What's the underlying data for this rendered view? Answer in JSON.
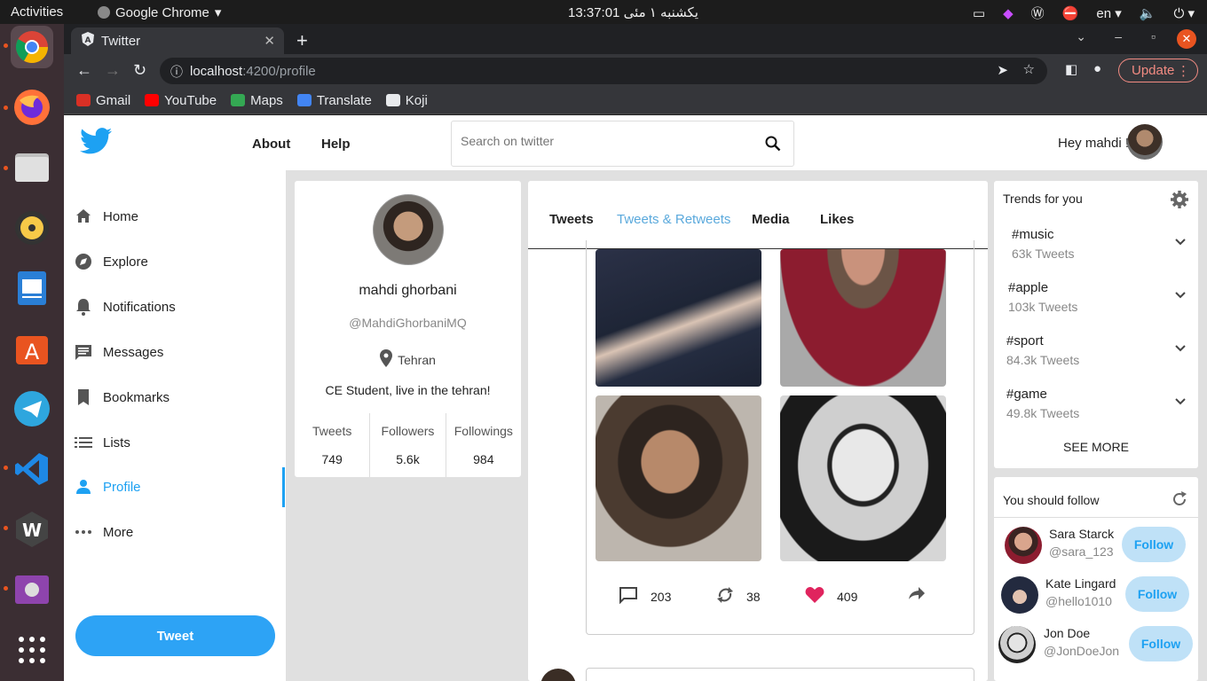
{
  "os": {
    "activities": "Activities",
    "app_name": "Google Chrome",
    "clock": "13:37:01 یکشنبه ۱ مئی",
    "lang": "en"
  },
  "browser": {
    "tab_title": "Twitter",
    "url_host": "localhost",
    "url_path": ":4200/profile",
    "update_label": "Update",
    "bookmarks": [
      {
        "label": "Gmail",
        "color": "#d93025"
      },
      {
        "label": "YouTube",
        "color": "#ff0000"
      },
      {
        "label": "Maps",
        "color": "#34a853"
      },
      {
        "label": "Translate",
        "color": "#4285f4"
      },
      {
        "label": "Koji",
        "color": "#222222"
      }
    ]
  },
  "header": {
    "nav_about": "About",
    "nav_help": "Help",
    "search_placeholder": "Search on twitter",
    "greeting": "Hey mahdi !"
  },
  "sidebar": {
    "items": [
      {
        "label": "Home",
        "icon": "home-icon"
      },
      {
        "label": "Explore",
        "icon": "explore-icon"
      },
      {
        "label": "Notifications",
        "icon": "bell-icon"
      },
      {
        "label": "Messages",
        "icon": "message-icon"
      },
      {
        "label": "Bookmarks",
        "icon": "bookmark-icon"
      },
      {
        "label": "Lists",
        "icon": "list-icon"
      },
      {
        "label": "Profile",
        "icon": "person-icon"
      },
      {
        "label": "More",
        "icon": "more-icon"
      }
    ],
    "active": "Profile",
    "tweet_button": "Tweet"
  },
  "profile": {
    "name": "mahdi ghorbani",
    "handle": "@MahdiGhorbaniMQ",
    "location": "Tehran",
    "bio": "CE Student, live in the tehran!",
    "stats": [
      {
        "label": "Tweets",
        "value": "749"
      },
      {
        "label": "Followers",
        "value": "5.6k"
      },
      {
        "label": "Followings",
        "value": "984"
      }
    ]
  },
  "feed": {
    "tabs": [
      "Tweets",
      "Tweets & Retweets",
      "Media",
      "Likes"
    ],
    "active_tab": "Tweets & Retweets",
    "tweet": {
      "replies": "203",
      "retweets": "38",
      "likes": "409"
    }
  },
  "trends": {
    "title": "Trends for you",
    "items": [
      {
        "tag": "#music",
        "count": "63k Tweets"
      },
      {
        "tag": "#apple",
        "count": "103k Tweets"
      },
      {
        "tag": "#sport",
        "count": "84.3k Tweets"
      },
      {
        "tag": "#game",
        "count": "49.8k Tweets"
      }
    ],
    "see_more": "SEE MORE"
  },
  "who_to_follow": {
    "title": "You should follow",
    "users": [
      {
        "name": "Sara Starck",
        "handle": "@sara_123",
        "button": "Follow"
      },
      {
        "name": "Kate Lingard",
        "handle": "@hello1010",
        "button": "Follow"
      },
      {
        "name": "Jon Doe",
        "handle": "@JonDoeJon",
        "button": "Follow"
      }
    ]
  },
  "colors": {
    "accent": "#1da1f2",
    "like": "#e0245e"
  }
}
